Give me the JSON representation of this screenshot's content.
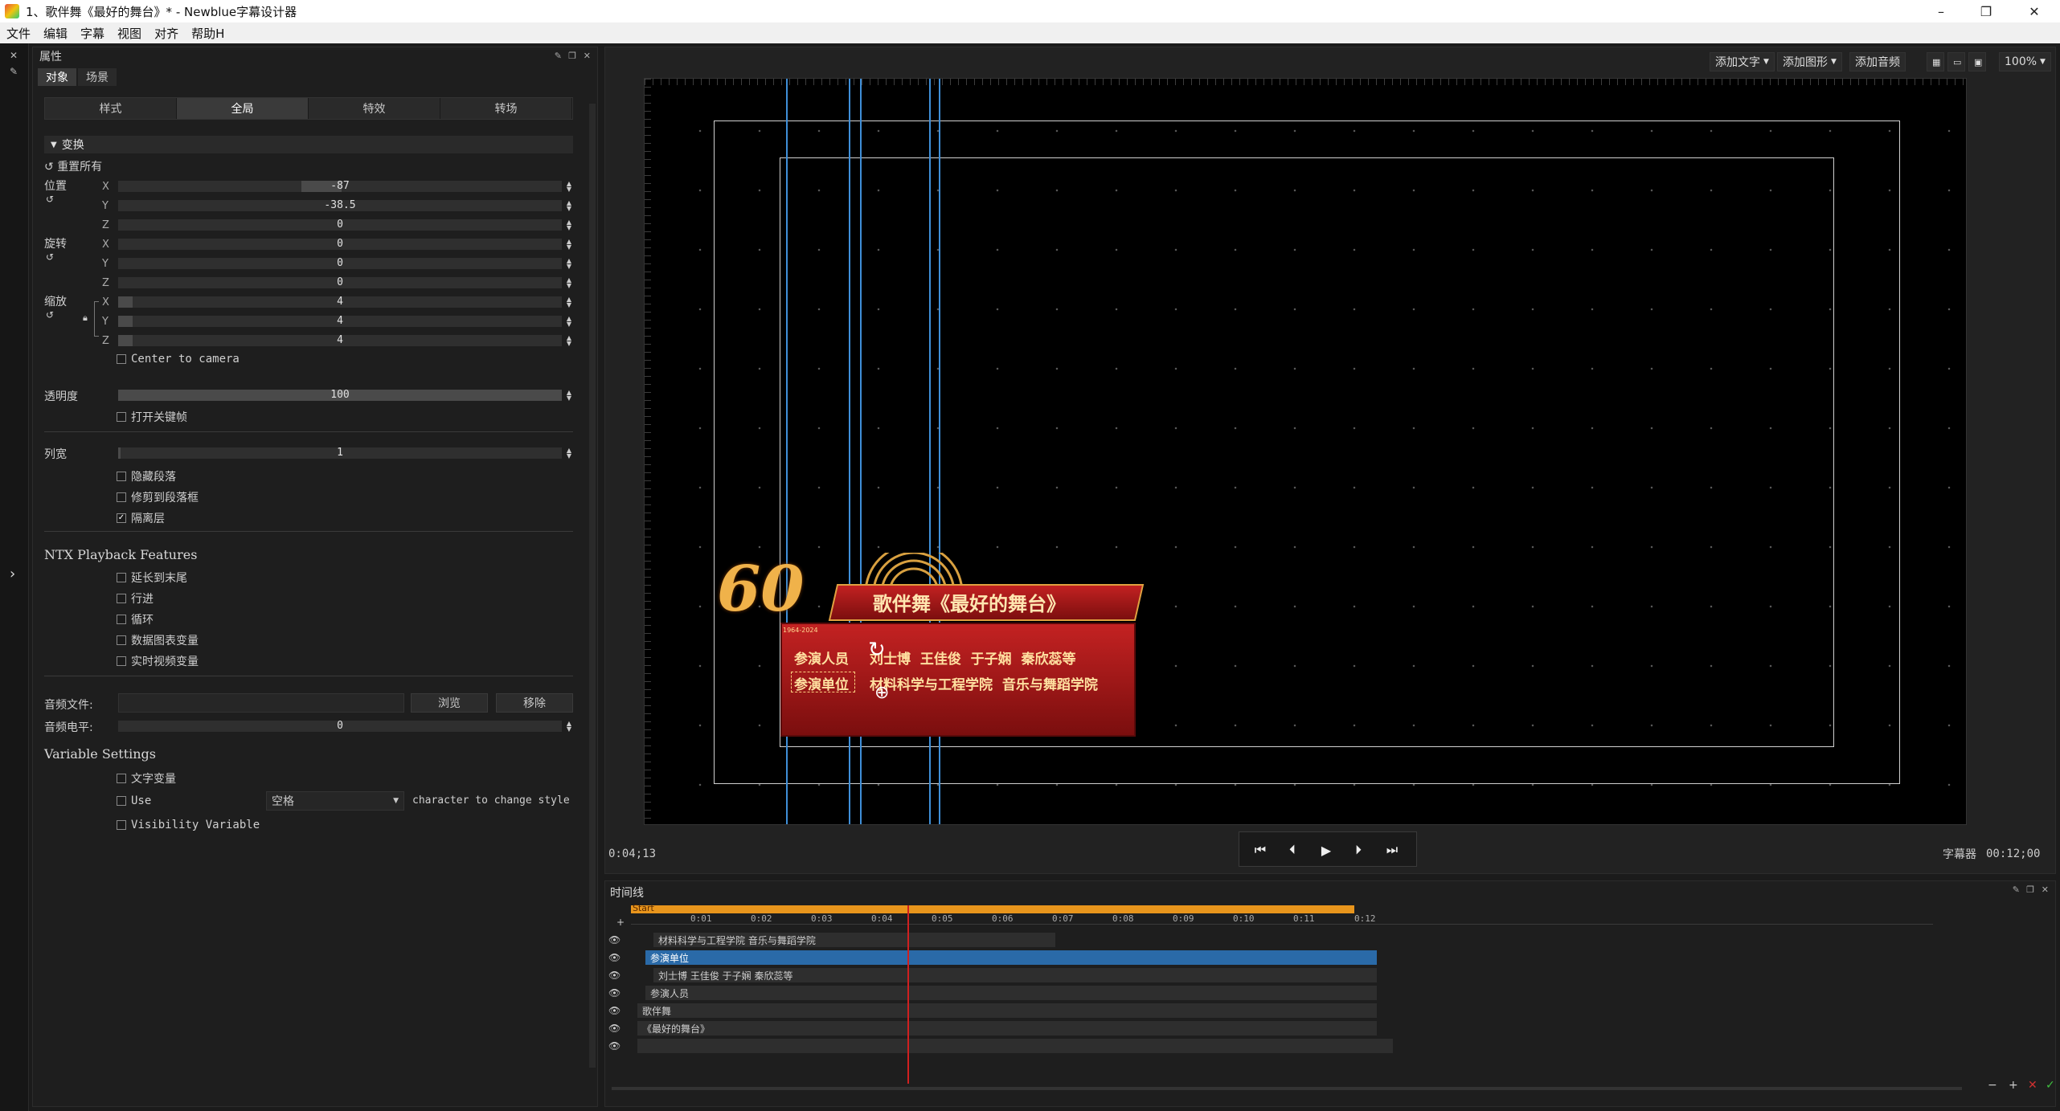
{
  "window": {
    "title": "1、歌伴舞《最好的舞台》* - Newblue字幕设计器",
    "minimize": "–",
    "restore": "❐",
    "close": "✕"
  },
  "menu": [
    "文件",
    "编辑",
    "字幕",
    "视图",
    "对齐",
    "帮助H"
  ],
  "properties": {
    "title": "属性",
    "tabs": [
      "对象",
      "场景"
    ],
    "subtabs": [
      "样式",
      "全局",
      "特效",
      "转场"
    ],
    "transform": {
      "section": "变换",
      "reset_all": "重置所有",
      "position_label": "位置",
      "rotation_label": "旋转",
      "scale_label": "缩放",
      "axes": [
        "X",
        "Y",
        "Z"
      ],
      "position": [
        "-87",
        "-38.5",
        "0"
      ],
      "rotation": [
        "0",
        "0",
        "0"
      ],
      "scale": [
        "4",
        "4",
        "4"
      ],
      "center_to_camera": "Center to camera"
    },
    "opacity_label": "透明度",
    "opacity_value": "100",
    "opacity_fill": 1.0,
    "keyframe_label": "打开关键帧",
    "column_width_label": "列宽",
    "column_width_value": "1",
    "hide_paragraph": "隐藏段落",
    "clip_to_paragraph": "修剪到段落框",
    "isolate_layer": "隔离层",
    "ntx_title": "NTX Playback Features",
    "ntx_items": [
      "延长到末尾",
      "行进",
      "循环",
      "数据图表变量",
      "实时视频变量"
    ],
    "audio_file_label": "音频文件:",
    "browse": "浏览",
    "remove": "移除",
    "audio_level_label": "音频电平:",
    "audio_level_value": "0",
    "variable_title": "Variable Settings",
    "text_variable": "文字变量",
    "use_label": "Use",
    "use_select": "空格",
    "change_style": "character to change style",
    "visibility_variable": "Visibility Variable"
  },
  "viewer": {
    "add_text": "添加文字",
    "add_shape": "添加图形",
    "add_audio": "添加音频",
    "zoom": "100%",
    "current_time": "0:04;13",
    "duration_label": "字幕器",
    "duration": "00:12;00"
  },
  "graphic": {
    "title": "歌伴舞《最好的舞台》",
    "row1_label": "参演人员",
    "row1_value": "刘士博  王佳俊  于子娴  秦欣蕊等",
    "row2_label": "参演单位",
    "row2_value": "材料科学与工程学院  音乐与舞蹈学院",
    "logo_num": "60",
    "logo_years": "1964-2024"
  },
  "timeline": {
    "title": "时间线",
    "start_label": "Start",
    "ticks": [
      "0:01",
      "0:02",
      "0:03",
      "0:04",
      "0:05",
      "0:06",
      "0:07",
      "0:08",
      "0:09",
      "0:10",
      "0:11",
      "0:12"
    ],
    "tracks": [
      "材料科学与工程学院  音乐与舞蹈学院",
      "参演单位",
      "刘士博  王佳俊  于子娴  秦欣蕊等",
      "参演人员",
      "歌伴舞",
      "《最好的舞台》"
    ]
  },
  "colors": {
    "accent_blue": "#3f8fd8",
    "timeline_orange": "#e8951c",
    "playhead": "#d02020",
    "selected_track": "#2a6aa8",
    "banner_red": "#a81a1a",
    "gold": "#e8b040"
  }
}
